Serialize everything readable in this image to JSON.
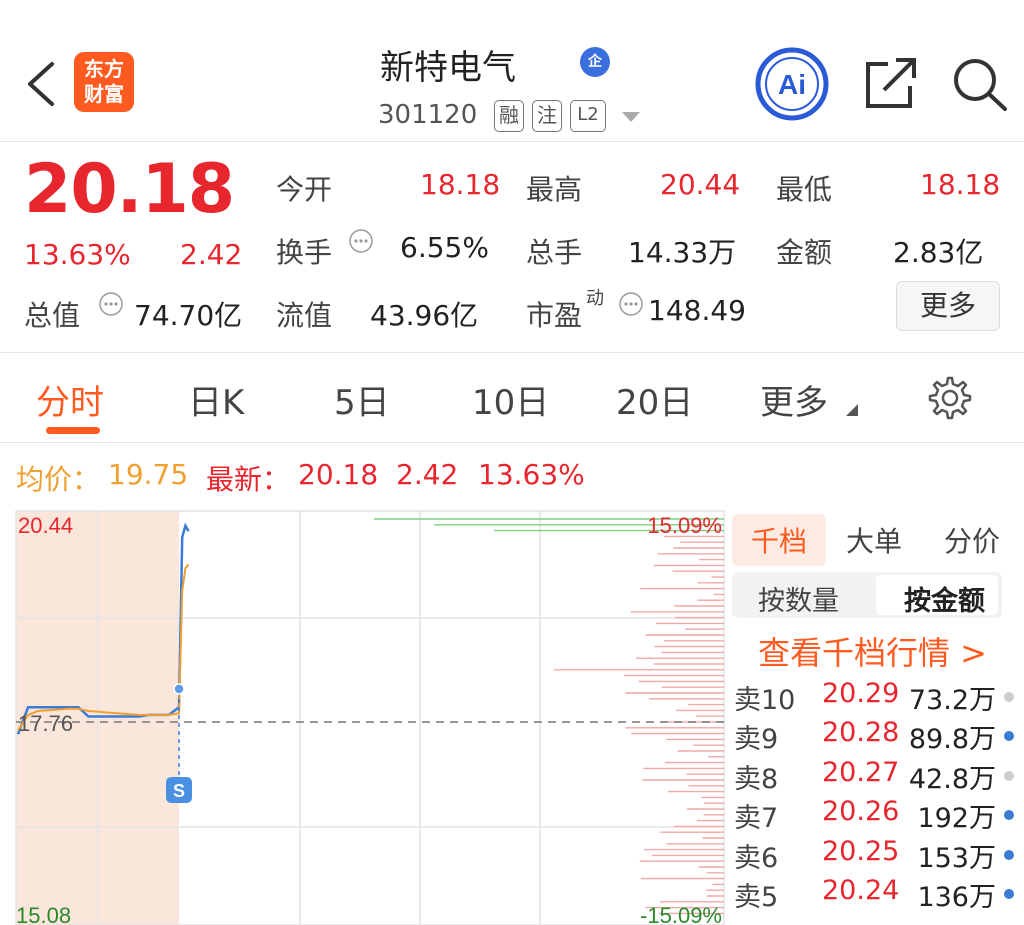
{
  "header": {
    "logo_line1": "东方",
    "logo_line2": "财富",
    "stock_name": "新特电气",
    "badge": "企",
    "stock_code": "301120",
    "tags": [
      "融",
      "注",
      "L2"
    ],
    "ai_label": "Ai"
  },
  "quote": {
    "price": "20.18",
    "change_pct": "13.63%",
    "change_amt": "2.42",
    "stats": [
      {
        "label": "今开",
        "value": "18.18",
        "color": "red"
      },
      {
        "label": "最高",
        "value": "20.44",
        "color": "red"
      },
      {
        "label": "最低",
        "value": "18.18",
        "color": "red"
      },
      {
        "label": "换手",
        "value": "6.55%",
        "color": "dark"
      },
      {
        "label": "总手",
        "value": "14.33万",
        "color": "dark"
      },
      {
        "label": "金额",
        "value": "2.83亿",
        "color": "dark"
      },
      {
        "label": "总值",
        "value": "74.70亿",
        "color": "dark"
      },
      {
        "label": "流值",
        "value": "43.96亿",
        "color": "dark"
      },
      {
        "label": "市盈",
        "label_sup": "动",
        "value": "148.49",
        "color": "dark"
      }
    ],
    "more_button": "更多"
  },
  "tabs": [
    "分时",
    "日K",
    "5日",
    "10日",
    "20日",
    "更多"
  ],
  "active_tab": "分时",
  "info": {
    "avg_label": "均价：",
    "avg_value": "19.75",
    "latest_label": "最新：",
    "latest_value": "20.18",
    "latest_change": "2.42",
    "latest_pct": "13.63%"
  },
  "chart_data": {
    "type": "line",
    "y_top_label": "20.44",
    "y_mid_label": "17.76",
    "y_bottom_label": "15.08",
    "pct_top_label": "15.09%",
    "pct_bottom_label": "-15.09%",
    "ylim": [
      15.08,
      20.44
    ],
    "prev_close": 17.76,
    "series": [
      {
        "color": "#3a7bd5",
        "values": [
          17.55,
          17.9,
          17.9,
          17.9,
          17.9,
          17.9,
          17.9,
          17.78,
          17.78,
          17.78,
          17.78,
          17.78,
          17.78,
          17.8,
          17.8,
          17.8,
          17.9,
          20.1,
          20.25,
          20.18
        ]
      },
      {
        "color": "#f0a030",
        "values": [
          17.6,
          17.8,
          17.85,
          17.86,
          17.87,
          17.88,
          17.88,
          17.85,
          17.84,
          17.83,
          17.82,
          17.81,
          17.8,
          17.8,
          17.8,
          17.8,
          17.82,
          19.4,
          19.7,
          19.75
        ]
      }
    ],
    "signal_marker": "S"
  },
  "right_panel": {
    "tabs": [
      "千档",
      "大单",
      "分价"
    ],
    "active_tab": "千档",
    "segments": [
      "按数量",
      "按金额"
    ],
    "active_segment": "按金额",
    "link": "查看千档行情 >",
    "rows": [
      {
        "level": "卖10",
        "price": "20.29",
        "volume": "73.2万",
        "dot": "#cccccc"
      },
      {
        "level": "卖9",
        "price": "20.28",
        "volume": "89.8万",
        "dot": "#3a7bd5"
      },
      {
        "level": "卖8",
        "price": "20.27",
        "volume": "42.8万",
        "dot": "#cccccc"
      },
      {
        "level": "卖7",
        "price": "20.26",
        "volume": "192万",
        "dot": "#3a7bd5"
      },
      {
        "level": "卖6",
        "price": "20.25",
        "volume": "153万",
        "dot": "#3a7bd5"
      },
      {
        "level": "卖5",
        "price": "20.24",
        "volume": "136万",
        "dot": "#3a7bd5"
      }
    ]
  },
  "colors": {
    "up": "#e8262e",
    "accent": "#ff5a1f",
    "avg": "#f0a030",
    "line": "#3a7bd5"
  }
}
